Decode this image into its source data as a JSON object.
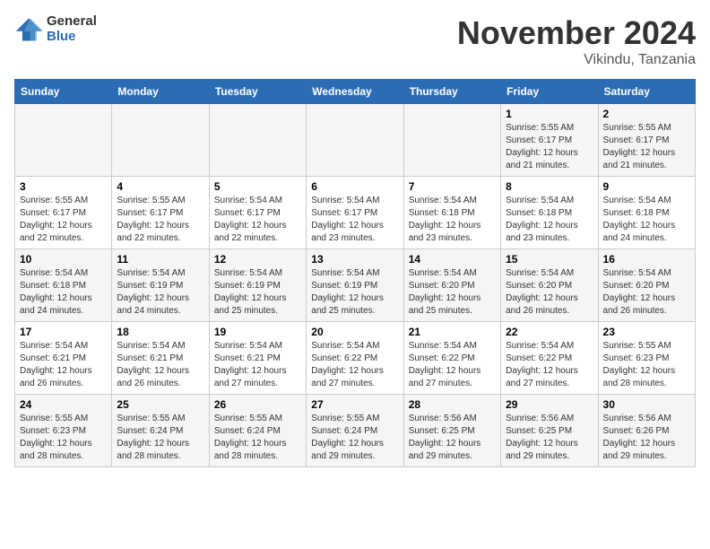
{
  "logo": {
    "general": "General",
    "blue": "Blue"
  },
  "title": "November 2024",
  "subtitle": "Vikindu, Tanzania",
  "days_of_week": [
    "Sunday",
    "Monday",
    "Tuesday",
    "Wednesday",
    "Thursday",
    "Friday",
    "Saturday"
  ],
  "weeks": [
    [
      {
        "day": "",
        "info": ""
      },
      {
        "day": "",
        "info": ""
      },
      {
        "day": "",
        "info": ""
      },
      {
        "day": "",
        "info": ""
      },
      {
        "day": "",
        "info": ""
      },
      {
        "day": "1",
        "info": "Sunrise: 5:55 AM\nSunset: 6:17 PM\nDaylight: 12 hours\nand 21 minutes."
      },
      {
        "day": "2",
        "info": "Sunrise: 5:55 AM\nSunset: 6:17 PM\nDaylight: 12 hours\nand 21 minutes."
      }
    ],
    [
      {
        "day": "3",
        "info": "Sunrise: 5:55 AM\nSunset: 6:17 PM\nDaylight: 12 hours\nand 22 minutes."
      },
      {
        "day": "4",
        "info": "Sunrise: 5:55 AM\nSunset: 6:17 PM\nDaylight: 12 hours\nand 22 minutes."
      },
      {
        "day": "5",
        "info": "Sunrise: 5:54 AM\nSunset: 6:17 PM\nDaylight: 12 hours\nand 22 minutes."
      },
      {
        "day": "6",
        "info": "Sunrise: 5:54 AM\nSunset: 6:17 PM\nDaylight: 12 hours\nand 23 minutes."
      },
      {
        "day": "7",
        "info": "Sunrise: 5:54 AM\nSunset: 6:18 PM\nDaylight: 12 hours\nand 23 minutes."
      },
      {
        "day": "8",
        "info": "Sunrise: 5:54 AM\nSunset: 6:18 PM\nDaylight: 12 hours\nand 23 minutes."
      },
      {
        "day": "9",
        "info": "Sunrise: 5:54 AM\nSunset: 6:18 PM\nDaylight: 12 hours\nand 24 minutes."
      }
    ],
    [
      {
        "day": "10",
        "info": "Sunrise: 5:54 AM\nSunset: 6:18 PM\nDaylight: 12 hours\nand 24 minutes."
      },
      {
        "day": "11",
        "info": "Sunrise: 5:54 AM\nSunset: 6:19 PM\nDaylight: 12 hours\nand 24 minutes."
      },
      {
        "day": "12",
        "info": "Sunrise: 5:54 AM\nSunset: 6:19 PM\nDaylight: 12 hours\nand 25 minutes."
      },
      {
        "day": "13",
        "info": "Sunrise: 5:54 AM\nSunset: 6:19 PM\nDaylight: 12 hours\nand 25 minutes."
      },
      {
        "day": "14",
        "info": "Sunrise: 5:54 AM\nSunset: 6:20 PM\nDaylight: 12 hours\nand 25 minutes."
      },
      {
        "day": "15",
        "info": "Sunrise: 5:54 AM\nSunset: 6:20 PM\nDaylight: 12 hours\nand 26 minutes."
      },
      {
        "day": "16",
        "info": "Sunrise: 5:54 AM\nSunset: 6:20 PM\nDaylight: 12 hours\nand 26 minutes."
      }
    ],
    [
      {
        "day": "17",
        "info": "Sunrise: 5:54 AM\nSunset: 6:21 PM\nDaylight: 12 hours\nand 26 minutes."
      },
      {
        "day": "18",
        "info": "Sunrise: 5:54 AM\nSunset: 6:21 PM\nDaylight: 12 hours\nand 26 minutes."
      },
      {
        "day": "19",
        "info": "Sunrise: 5:54 AM\nSunset: 6:21 PM\nDaylight: 12 hours\nand 27 minutes."
      },
      {
        "day": "20",
        "info": "Sunrise: 5:54 AM\nSunset: 6:22 PM\nDaylight: 12 hours\nand 27 minutes."
      },
      {
        "day": "21",
        "info": "Sunrise: 5:54 AM\nSunset: 6:22 PM\nDaylight: 12 hours\nand 27 minutes."
      },
      {
        "day": "22",
        "info": "Sunrise: 5:54 AM\nSunset: 6:22 PM\nDaylight: 12 hours\nand 27 minutes."
      },
      {
        "day": "23",
        "info": "Sunrise: 5:55 AM\nSunset: 6:23 PM\nDaylight: 12 hours\nand 28 minutes."
      }
    ],
    [
      {
        "day": "24",
        "info": "Sunrise: 5:55 AM\nSunset: 6:23 PM\nDaylight: 12 hours\nand 28 minutes."
      },
      {
        "day": "25",
        "info": "Sunrise: 5:55 AM\nSunset: 6:24 PM\nDaylight: 12 hours\nand 28 minutes."
      },
      {
        "day": "26",
        "info": "Sunrise: 5:55 AM\nSunset: 6:24 PM\nDaylight: 12 hours\nand 28 minutes."
      },
      {
        "day": "27",
        "info": "Sunrise: 5:55 AM\nSunset: 6:24 PM\nDaylight: 12 hours\nand 29 minutes."
      },
      {
        "day": "28",
        "info": "Sunrise: 5:56 AM\nSunset: 6:25 PM\nDaylight: 12 hours\nand 29 minutes."
      },
      {
        "day": "29",
        "info": "Sunrise: 5:56 AM\nSunset: 6:25 PM\nDaylight: 12 hours\nand 29 minutes."
      },
      {
        "day": "30",
        "info": "Sunrise: 5:56 AM\nSunset: 6:26 PM\nDaylight: 12 hours\nand 29 minutes."
      }
    ]
  ]
}
